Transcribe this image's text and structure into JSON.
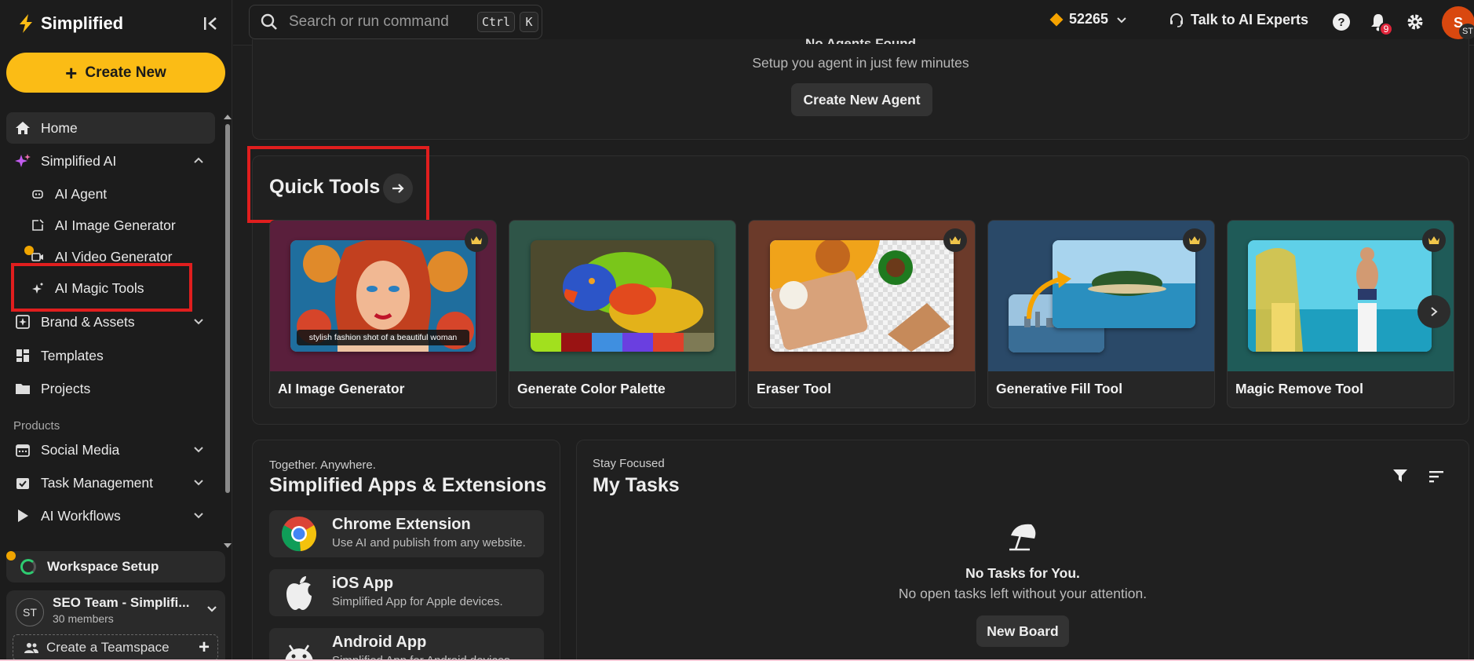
{
  "sidebar": {
    "brand": "Simplified",
    "create_label": "Create New",
    "home": "Home",
    "simplified_ai": "Simplified AI",
    "sub_items": [
      "AI Agent",
      "AI Image Generator",
      "AI Video Generator",
      "AI Magic Tools"
    ],
    "brand_assets": "Brand & Assets",
    "templates": "Templates",
    "projects": "Projects",
    "products_label": "Products",
    "social_media": "Social Media",
    "task_management": "Task Management",
    "ai_workflows": "AI Workflows",
    "workspace_setup": "Workspace Setup",
    "team": {
      "initials": "ST",
      "name": "SEO Team - Simplifi...",
      "members": "30 members"
    },
    "create_teamspace": "Create a Teamspace"
  },
  "topbar": {
    "search_placeholder": "Search or run command",
    "kbd_ctrl": "Ctrl",
    "kbd_k": "K",
    "credits": "52265",
    "talk": "Talk to AI Experts",
    "notifications": "9",
    "avatar_letter": "S",
    "avatar_tag": "ST"
  },
  "agents": {
    "title": "No Agents Found",
    "subtitle": "Setup you agent in just few minutes",
    "button": "Create New Agent"
  },
  "quick_tools": {
    "title": "Quick Tools",
    "tools": [
      {
        "name": "AI Image Generator",
        "caption": "stylish fashion shot of a beautiful woman",
        "bg": "#5a1f3c"
      },
      {
        "name": "Generate Color Palette",
        "bg": "#2f5548"
      },
      {
        "name": "Eraser Tool",
        "bg": "#6b3a2a"
      },
      {
        "name": "Generative Fill Tool",
        "bg": "#2a4968"
      },
      {
        "name": "Magic Remove Tool",
        "bg": "#1f5b58"
      }
    ],
    "palette": [
      "#a2e01e",
      "#991313",
      "#3f8fe0",
      "#6a3fe0",
      "#e0402a",
      "#7e7a55"
    ]
  },
  "apps": {
    "eyebrow": "Together. Anywhere.",
    "title": "Simplified Apps & Extensions",
    "items": [
      {
        "name": "Chrome Extension",
        "desc": "Use AI and publish from any website."
      },
      {
        "name": "iOS App",
        "desc": "Simplified App for Apple devices."
      },
      {
        "name": "Android App",
        "desc": "Simplified App for Android devices."
      }
    ]
  },
  "tasks": {
    "eyebrow": "Stay Focused",
    "title": "My Tasks",
    "empty_title": "No Tasks for You.",
    "empty_sub": "No open tasks left without your attention.",
    "button": "New Board"
  },
  "colors": {
    "accent": "#fbbc15",
    "highlight": "#e01e1e",
    "bg": "#1e1e1e"
  }
}
